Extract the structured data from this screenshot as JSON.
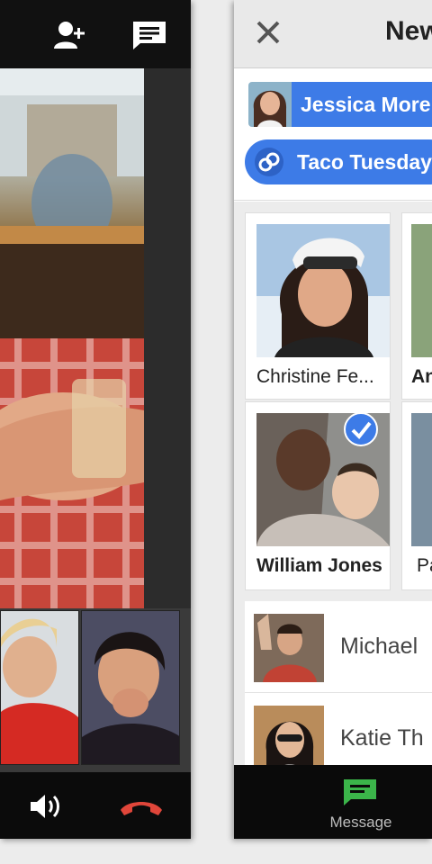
{
  "left_call": {
    "toolbar": {
      "add_person_icon": "person-add-icon",
      "chat_icon": "chat-icon"
    },
    "controls": {
      "speaker_icon": "speaker-icon",
      "hangup_icon": "phone-hangup-icon",
      "hangup_color": "#e0463a"
    }
  },
  "right_new": {
    "header": {
      "close_icon": "close-icon",
      "title": "New"
    },
    "recipients": [
      {
        "label": "Jessica Moren"
      },
      {
        "label": "Taco Tuesdays"
      }
    ],
    "contacts_grid": [
      {
        "name": "Christine Fe...",
        "selected": false
      },
      {
        "name": "William Jones",
        "selected": true
      }
    ],
    "contacts_peek": [
      {
        "name": "An"
      },
      {
        "name": "Pa"
      }
    ],
    "contacts_list": [
      {
        "name": "Michael"
      },
      {
        "name": "Katie Th"
      }
    ],
    "bottom_bar": {
      "tab_label": "Message",
      "tab_icon": "message-icon",
      "accent": "#3bb54a"
    },
    "chip_color": "#3d7be7"
  }
}
